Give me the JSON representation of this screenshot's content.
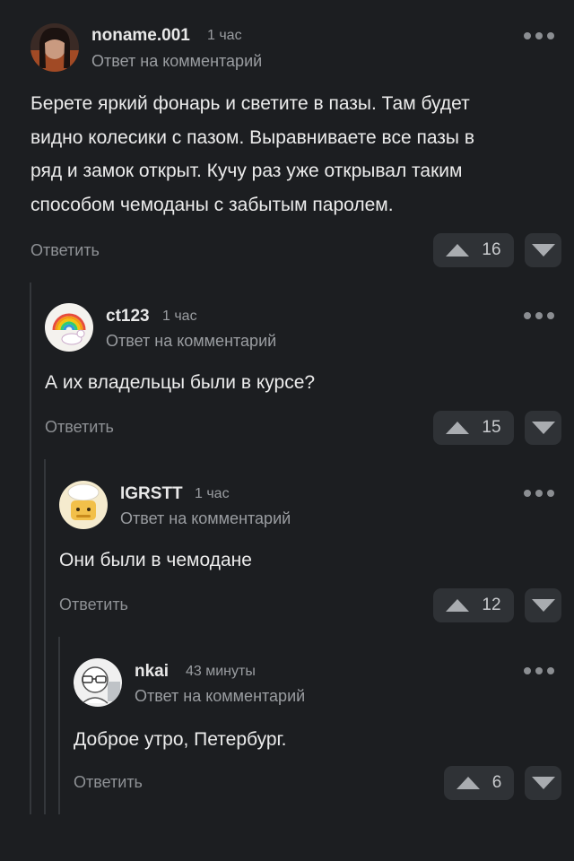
{
  "comments": [
    {
      "username": "noname.001",
      "time": "1 час",
      "subtitle": "Ответ на комментарий",
      "text_lines": [
        "Берете яркий фонарь и светите в пазы. Там будет",
        "видно колесики с пазом. Выравниваете все пазы в",
        "ряд и замок открыт. Кучу раз уже открывал таким",
        "способом чемоданы с забытым паролем."
      ],
      "reply_label": "Ответить",
      "votes": "16"
    },
    {
      "username": "ct123",
      "time": "1 час",
      "subtitle": "Ответ на комментарий",
      "text_lines": [
        "А их владельцы были в курсе?"
      ],
      "reply_label": "Ответить",
      "votes": "15"
    },
    {
      "username": "IGRSTT",
      "time": "1 час",
      "subtitle": "Ответ на комментарий",
      "text_lines": [
        "Они были в чемодане"
      ],
      "reply_label": "Ответить",
      "votes": "12"
    },
    {
      "username": "nkai",
      "time": "43 минуты",
      "subtitle": "Ответ на комментарий",
      "text_lines": [
        "Доброе утро, Петербург."
      ],
      "reply_label": "Ответить",
      "votes": "6"
    }
  ]
}
